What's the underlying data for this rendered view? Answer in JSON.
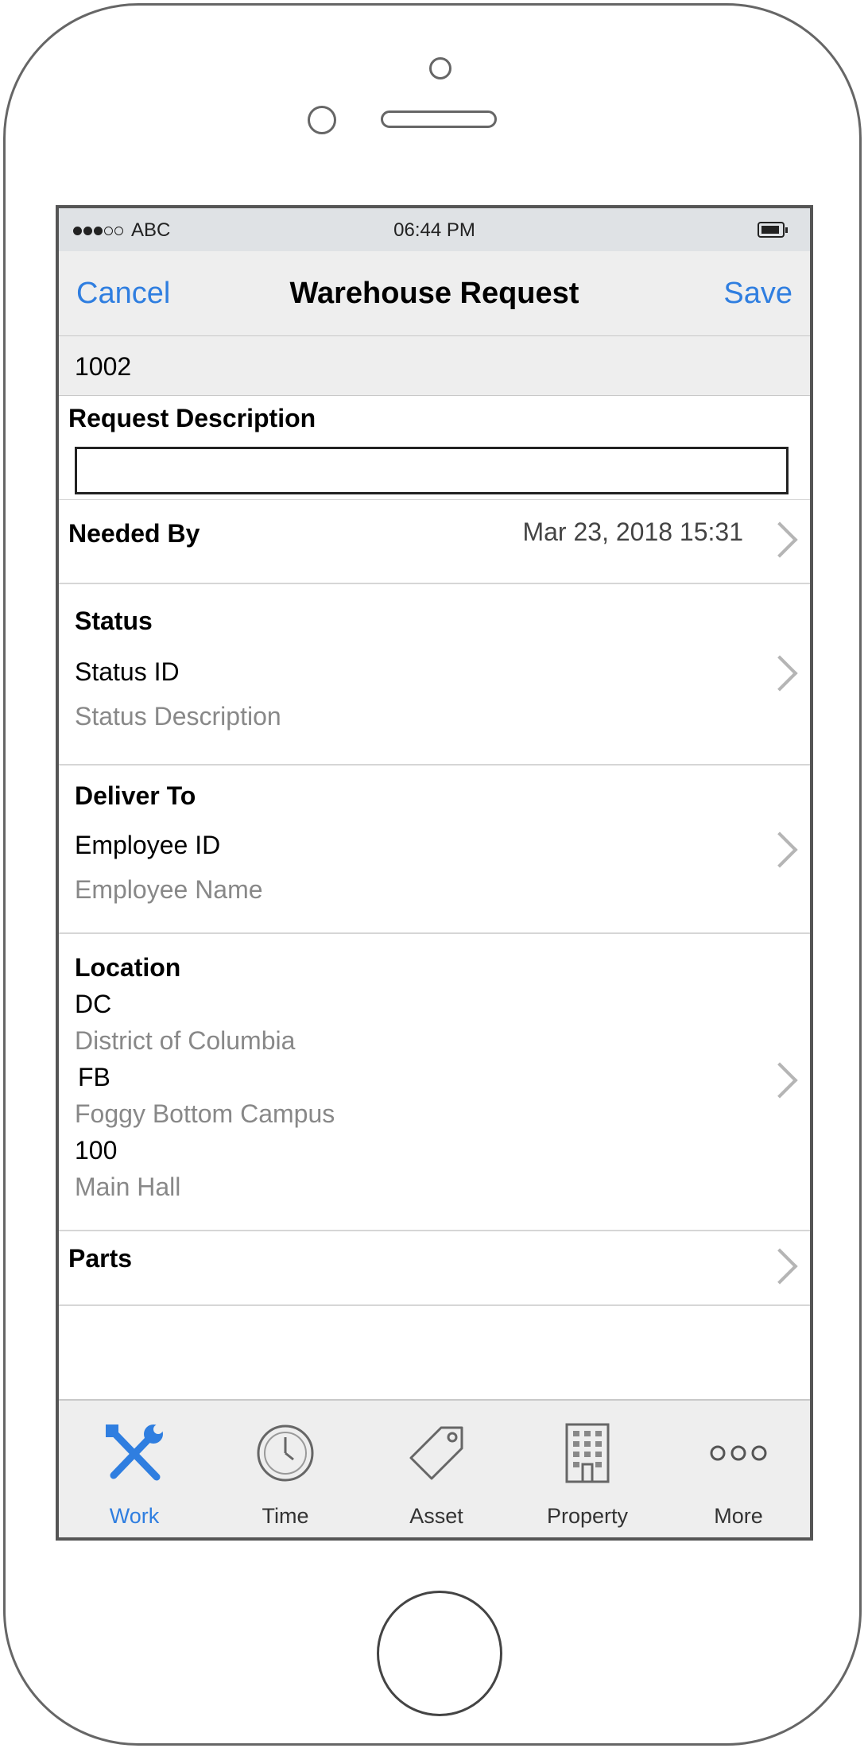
{
  "status_bar": {
    "carrier": "ABC",
    "time": "06:44 PM"
  },
  "nav": {
    "cancel": "Cancel",
    "title": "Warehouse Request",
    "save": "Save"
  },
  "record_id": "1002",
  "request_description": {
    "label": "Request Description",
    "value": ""
  },
  "needed_by": {
    "label": "Needed By",
    "value": "Mar 23, 2018 15:31"
  },
  "status": {
    "label": "Status",
    "id": "Status ID",
    "description": "Status Description"
  },
  "deliver_to": {
    "label": "Deliver To",
    "id": "Employee ID",
    "name": "Employee Name"
  },
  "location": {
    "label": "Location",
    "code1": "DC",
    "desc1": "District of Columbia",
    "code2": "FB",
    "desc2": "Foggy Bottom Campus",
    "code3": "100",
    "desc3": "Main Hall"
  },
  "parts": {
    "label": "Parts"
  },
  "tabs": [
    {
      "label": "Work",
      "icon": "tools-icon",
      "active": true
    },
    {
      "label": "Time",
      "icon": "clock-icon",
      "active": false
    },
    {
      "label": "Asset",
      "icon": "tag-icon",
      "active": false
    },
    {
      "label": "Property",
      "icon": "building-icon",
      "active": false
    },
    {
      "label": "More",
      "icon": "more-icon",
      "active": false
    }
  ],
  "colors": {
    "accent": "#2f7ee0",
    "chevron": "#b5b5b5",
    "secondary_text": "#888888"
  }
}
